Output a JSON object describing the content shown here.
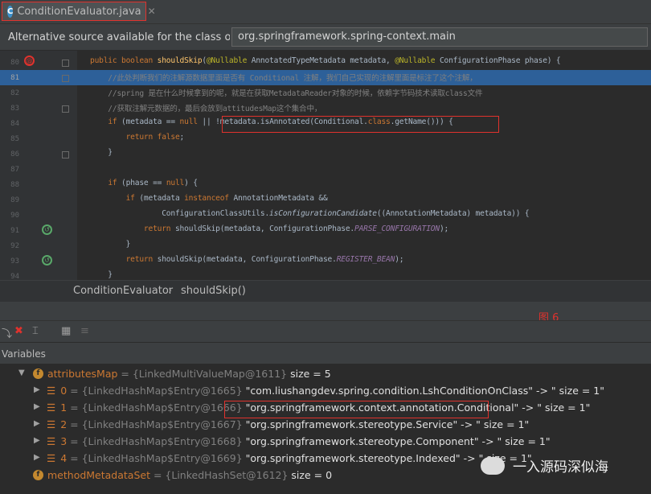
{
  "tab": {
    "title": "ConditionEvaluator.java",
    "icon": "C"
  },
  "infobar": {
    "message": "Alternative source available for the class org....",
    "selected_source": "org.springframework.spring-context.main"
  },
  "editor": {
    "line_numbers": [
      "80",
      "81",
      "82",
      "83",
      "84",
      "85",
      "86",
      "87",
      "88",
      "89",
      "90",
      "91",
      "92",
      "93",
      "94"
    ],
    "highlighted_line": "81",
    "code_lines": [
      "public boolean shouldSkip(@Nullable AnnotatedTypeMetadata metadata, @Nullable ConfigurationPhase phase) {",
      "    //此处判断我们的注解源数据里面是否有 Conditional 注解，我们自己实现的注解里面是标注了这个注解，",
      "    //spring 是在什么时候拿到的呢，就是在获取MetadataReader对象的时候，依赖字节码技术读取class文件",
      "    //获取注解元数据的，最后会放到attitudesMap这个集合中，",
      "    if (metadata == null || !metadata.isAnnotated(Conditional.class.getName())) {",
      "        return false;",
      "    }",
      "",
      "    if (phase == null) {",
      "        if (metadata instanceof AnnotationMetadata &&",
      "                ConfigurationClassUtils.isConfigurationCandidate((AnnotationMetadata) metadata)) {",
      "            return shouldSkip(metadata, ConfigurationPhase.PARSE_CONFIGURATION);",
      "        }",
      "        return shouldSkip(metadata, ConfigurationPhase.REGISTER_BEAN);",
      "    }"
    ]
  },
  "breadcrumb": {
    "class": "ConditionEvaluator",
    "method": "shouldSkip()"
  },
  "figure_label": "图  6",
  "variables_panel": {
    "title": "Variables",
    "rows": [
      {
        "name": "attributesMap",
        "type": " = {LinkedMultiValueMap@1611}",
        "value": "  size = 5"
      },
      {
        "name": "0",
        "type": " = {LinkedHashMap$Entry@1665}",
        "value": " \"com.liushangdev.spring.condition.LshConditionOnClass\" -> \" size = 1\""
      },
      {
        "name": "1",
        "type": " = {LinkedHashMap$Entry@1666}",
        "value": " \"org.springframework.context.annotation.Conditional\" -> \" size = 1\""
      },
      {
        "name": "2",
        "type": " = {LinkedHashMap$Entry@1667}",
        "value": " \"org.springframework.stereotype.Service\" -> \" size = 1\""
      },
      {
        "name": "3",
        "type": " = {LinkedHashMap$Entry@1668}",
        "value": " \"org.springframework.stereotype.Component\" -> \" size = 1\""
      },
      {
        "name": "4",
        "type": " = {LinkedHashMap$Entry@1669}",
        "value": " \"org.springframework.stereotype.Indexed\" -> \" size = 1\""
      },
      {
        "name": "methodMetadataSet",
        "type": " = {LinkedHashSet@1612}",
        "value": "  size = 0"
      }
    ]
  },
  "watermark": {
    "text": "一入源码深似海"
  },
  "colors": {
    "highlight": "#2d6099",
    "red_box": "#e0322d",
    "keyword": "#cc7832",
    "annotation": "#bbb529",
    "comment": "#808080"
  }
}
